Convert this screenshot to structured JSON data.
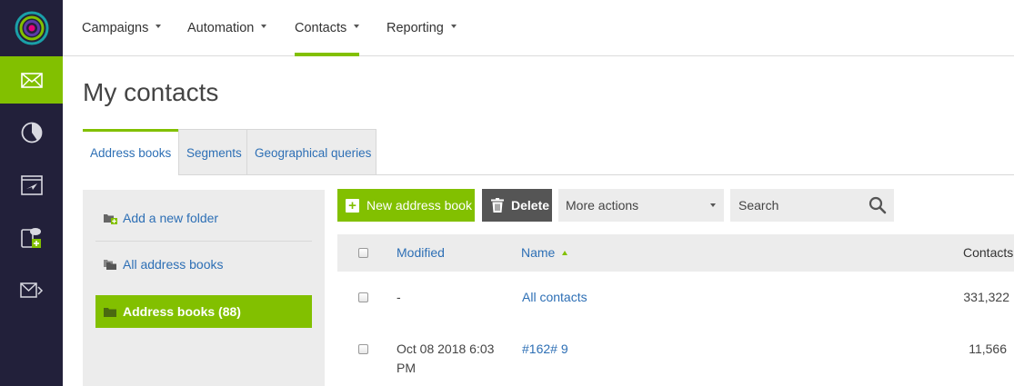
{
  "topnav": {
    "items": [
      {
        "label": "Campaigns",
        "active": false
      },
      {
        "label": "Automation",
        "active": false
      },
      {
        "label": "Contacts",
        "active": true
      },
      {
        "label": "Reporting",
        "active": false
      }
    ]
  },
  "leftbar": {
    "icons": [
      "envelope-icon",
      "pie-chart-icon",
      "browser-plane-icon",
      "device-add-icon",
      "envelope-code-icon"
    ],
    "active_icon": "envelope-icon"
  },
  "page": {
    "title": "My contacts"
  },
  "tabs": [
    {
      "label": "Address books",
      "active": true
    },
    {
      "label": "Segments",
      "active": false
    },
    {
      "label": "Geographical queries",
      "active": false
    }
  ],
  "sidebar": {
    "add_folder": "Add a new folder",
    "all_books": "All address books",
    "selected": "Address books (88)"
  },
  "toolbar": {
    "new_label": "New address book",
    "delete_label": "Delete",
    "more_label": "More actions",
    "search_placeholder": "Search"
  },
  "table": {
    "headers": {
      "modified": "Modified",
      "name": "Name",
      "contacts": "Contacts"
    },
    "rows": [
      {
        "modified": "-",
        "modified2": "",
        "name": "All contacts",
        "contacts": "331,322"
      },
      {
        "modified": "Oct 08 2018 6:03",
        "modified2": "PM",
        "name": "#162# 9",
        "contacts": "11,566"
      }
    ]
  },
  "colors": {
    "accent": "#82c000",
    "sidebar_bg": "#22203a",
    "link": "#2d6fb5"
  }
}
